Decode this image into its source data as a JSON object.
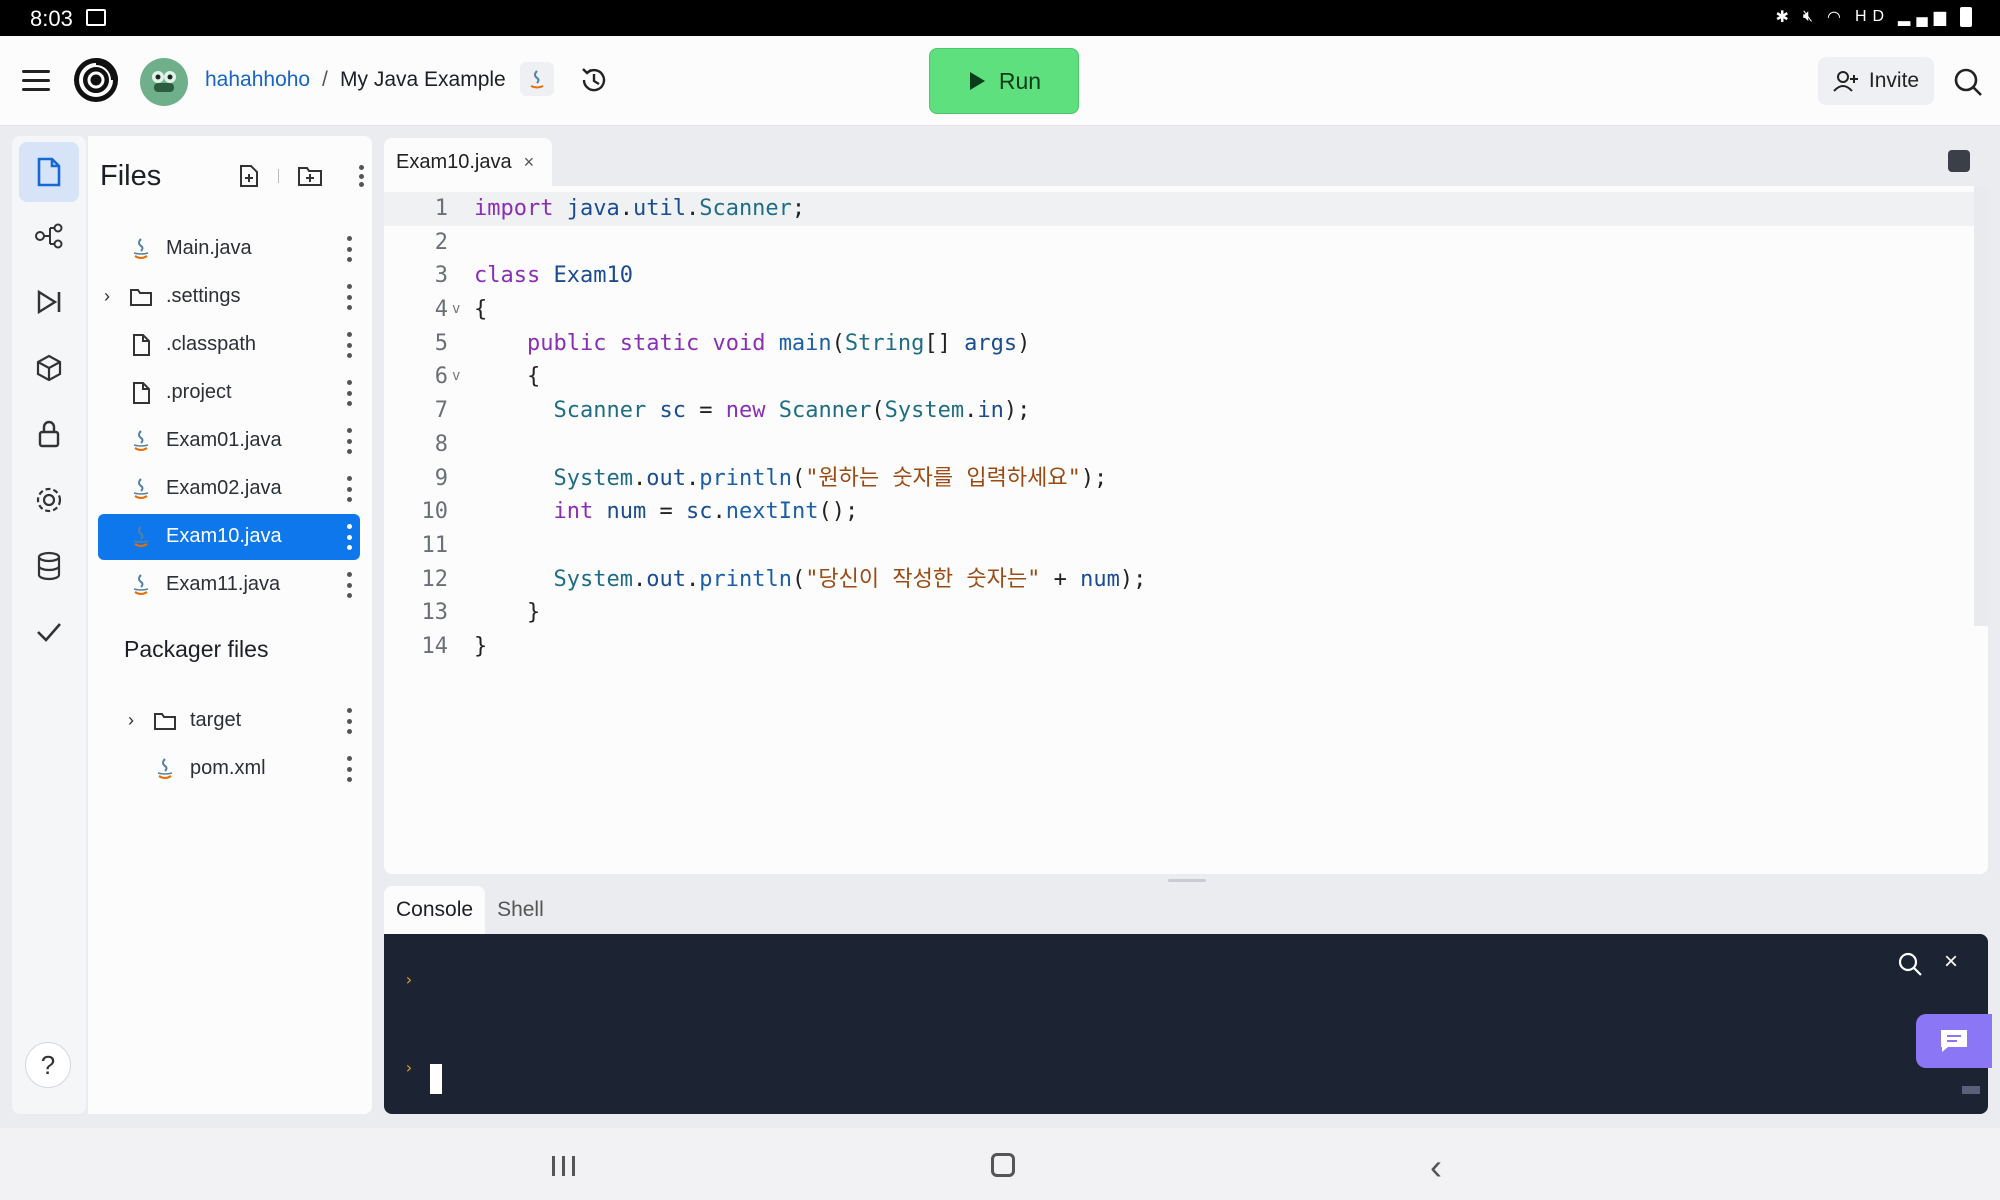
{
  "status_bar": {
    "time": "8:03",
    "indicators": "HD"
  },
  "header": {
    "user": "hahahhoho",
    "separator": "/",
    "project": "My Java Example",
    "run_label": "Run",
    "invite_label": "Invite"
  },
  "files_panel": {
    "title": "Files",
    "items": [
      {
        "name": "Main.java",
        "icon": "java-icon",
        "folder": false,
        "selected": false
      },
      {
        "name": ".settings",
        "icon": "folder-icon",
        "folder": true,
        "selected": false
      },
      {
        "name": ".classpath",
        "icon": "file-icon",
        "folder": false,
        "selected": false
      },
      {
        "name": ".project",
        "icon": "file-icon",
        "folder": false,
        "selected": false
      },
      {
        "name": "Exam01.java",
        "icon": "java-icon",
        "folder": false,
        "selected": false
      },
      {
        "name": "Exam02.java",
        "icon": "java-icon",
        "folder": false,
        "selected": false
      },
      {
        "name": "Exam10.java",
        "icon": "java-icon",
        "folder": false,
        "selected": true
      },
      {
        "name": "Exam11.java",
        "icon": "java-icon",
        "folder": false,
        "selected": false
      }
    ],
    "packager_title": "Packager files",
    "packager_items": [
      {
        "name": "target",
        "icon": "folder-icon",
        "folder": true
      },
      {
        "name": "pom.xml",
        "icon": "java-icon",
        "folder": false
      }
    ]
  },
  "editor": {
    "tab_name": "Exam10.java",
    "tab_close": "×",
    "line_numbers": [
      "1",
      "2",
      "3",
      "4",
      "5",
      "6",
      "7",
      "8",
      "9",
      "10",
      "11",
      "12",
      "13",
      "14"
    ],
    "fold_markers": {
      "4": "v",
      "6": "v"
    },
    "lines": [
      "import java.util.Scanner;",
      "",
      "class Exam10",
      "{",
      "    public static void main(String[] args)",
      "    {",
      "      Scanner sc = new Scanner(System.in);",
      "",
      "      System.out.println(\"원하는 숫자를 입력하세요\");",
      "      int num = sc.nextInt();",
      "",
      "      System.out.println(\"당신이 작성한 숫자는\" + num);",
      "    }",
      "}"
    ]
  },
  "bottom_panel": {
    "tabs": [
      "Console",
      "Shell"
    ],
    "active_tab": "Console",
    "prompt_symbol": "›",
    "close_symbol": "×"
  },
  "colors": {
    "run_button": "#5fe07e",
    "selected_file": "#0f77ec",
    "console_bg": "#1c2333",
    "chat_fab": "#8b76f5",
    "link": "#1765c1"
  }
}
